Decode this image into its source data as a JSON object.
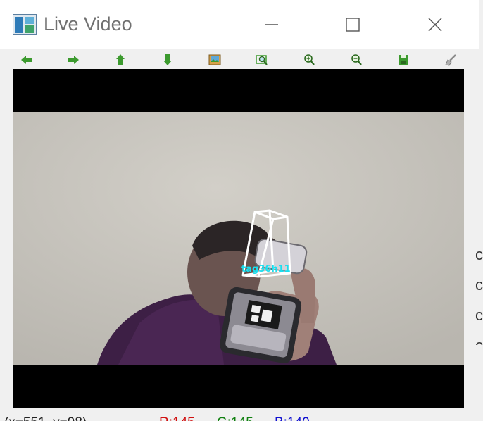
{
  "window": {
    "title": "Live Video"
  },
  "toolbar": {
    "buttons": [
      {
        "icon": "arrow-left-icon"
      },
      {
        "icon": "arrow-right-icon"
      },
      {
        "icon": "arrow-up-icon"
      },
      {
        "icon": "arrow-down-icon"
      },
      {
        "icon": "image-icon"
      },
      {
        "icon": "zoom-fit-icon"
      },
      {
        "icon": "zoom-in-icon"
      },
      {
        "icon": "zoom-out-icon"
      },
      {
        "icon": "save-icon"
      },
      {
        "icon": "brush-icon"
      }
    ]
  },
  "video": {
    "tag_label": "tag36h11"
  },
  "status": {
    "coords": "(x=551, y=98) ~",
    "r": "R:145",
    "g": "G:145",
    "b": "B:140"
  },
  "background_glyphs": [
    "c",
    "c",
    "c",
    "c"
  ],
  "colors": {
    "toolbar_green": "#3c9a2e",
    "tag_label": "#18e0f0",
    "status_r": "#d01010",
    "status_g": "#108010",
    "status_b": "#1010d0"
  }
}
